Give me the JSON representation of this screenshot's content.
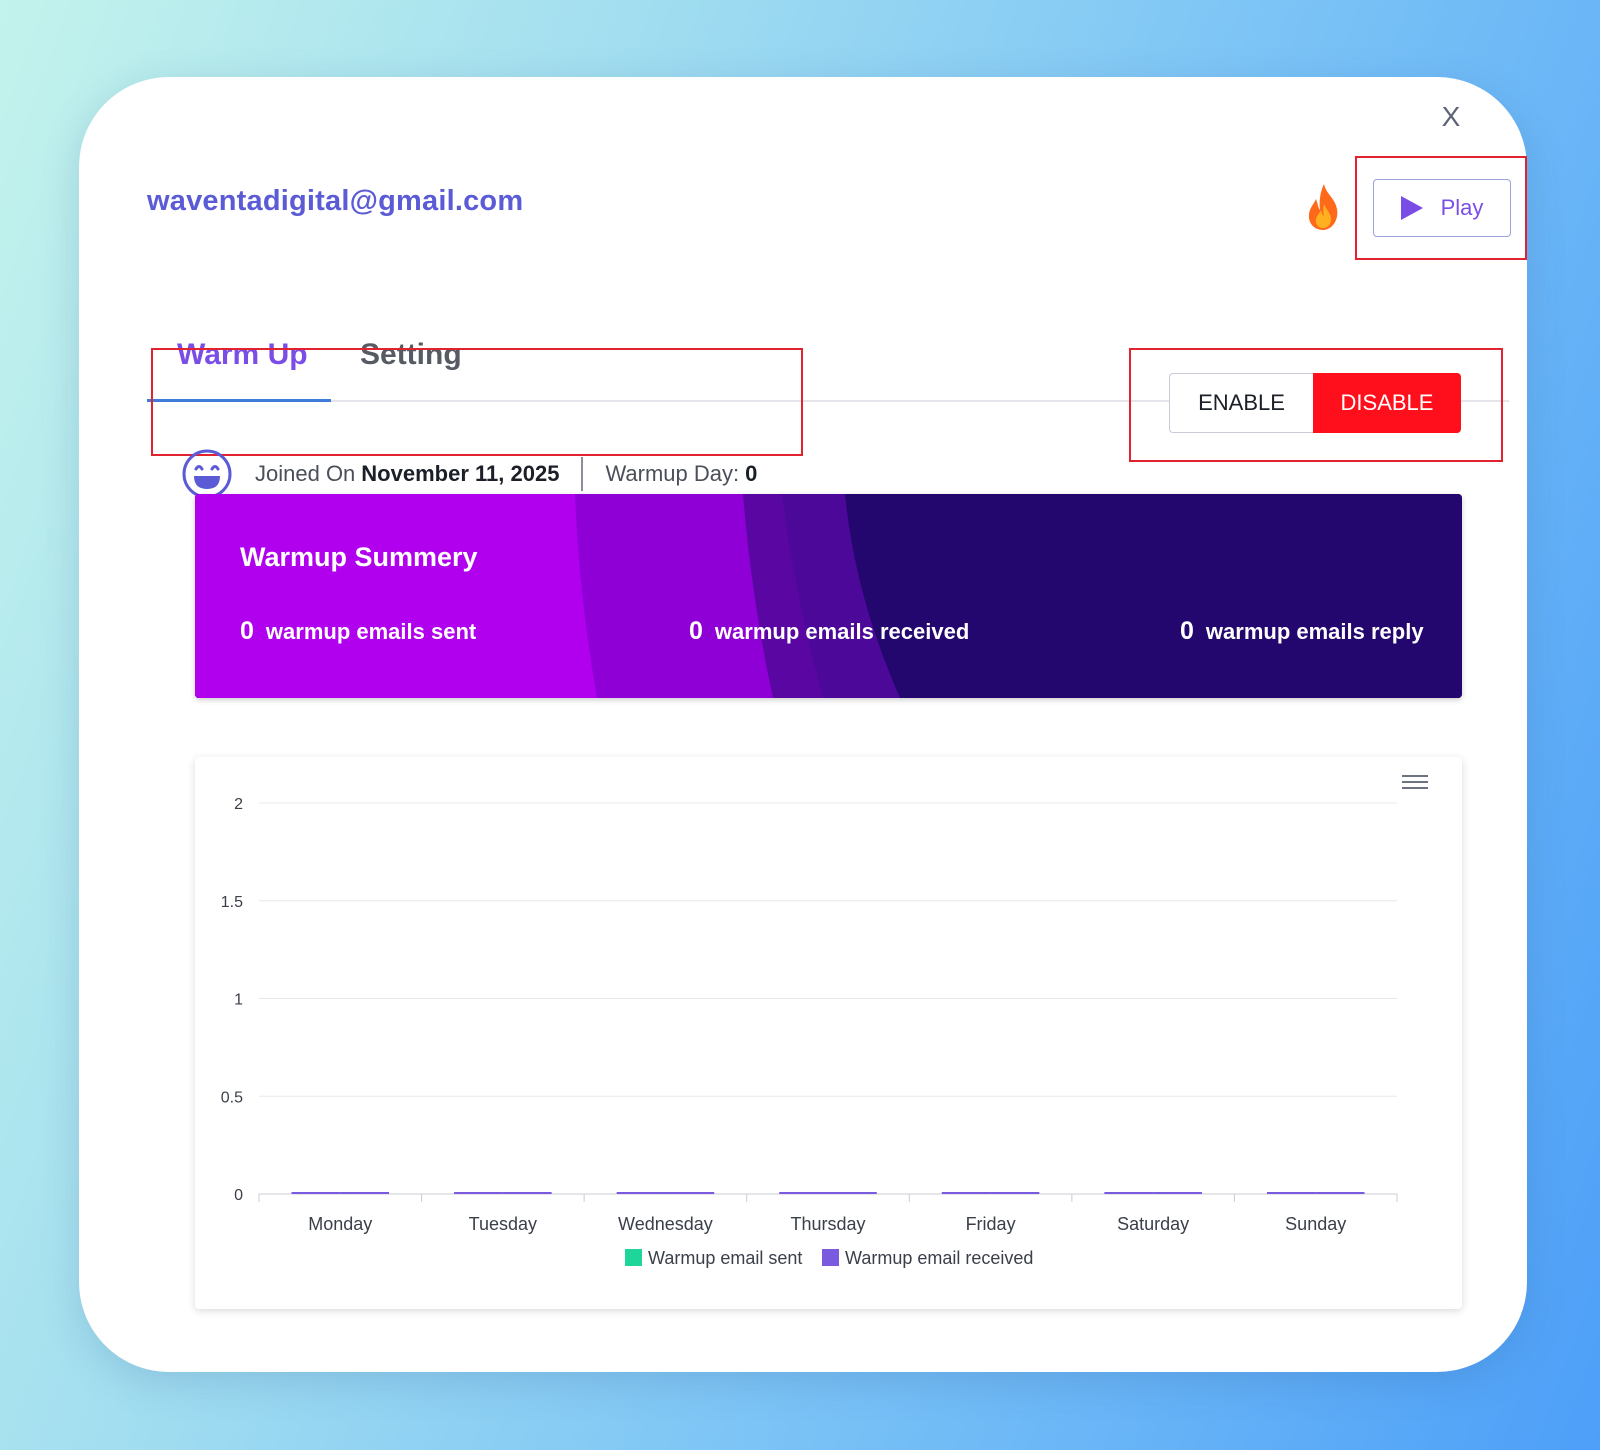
{
  "header": {
    "email": "waventadigital@gmail.com",
    "close_label": "X",
    "play_label": "Play"
  },
  "tabs": [
    {
      "label": "Warm Up",
      "active": true
    },
    {
      "label": "Setting",
      "active": false
    }
  ],
  "status": {
    "joined_label": "Joined On",
    "joined_date": "November 11, 2025",
    "warmup_day_label": "Warmup Day:",
    "warmup_day_value": "0"
  },
  "toggle": {
    "enable_label": "ENABLE",
    "disable_label": "DISABLE",
    "selected": "DISABLE"
  },
  "summary": {
    "title": "Warmup Summery",
    "stats": [
      {
        "value": "0",
        "label": "warmup emails sent"
      },
      {
        "value": "0",
        "label": "warmup emails received"
      },
      {
        "value": "0",
        "label": "warmup emails reply"
      }
    ]
  },
  "icons": {
    "close": "close-icon",
    "flame": "flame-icon",
    "play": "play-icon",
    "smiley": "smiley-icon",
    "menu": "menu-icon"
  },
  "colors": {
    "accent": "#7a4ee6",
    "email": "#5b5bd6",
    "disable": "#ff0f1b",
    "series_sent": "#1ed69a",
    "series_received": "#7a5be0"
  },
  "chart_data": {
    "type": "bar",
    "categories": [
      "Monday",
      "Tuesday",
      "Wednesday",
      "Thursday",
      "Friday",
      "Saturday",
      "Sunday"
    ],
    "series": [
      {
        "name": "Warmup email sent",
        "values": [
          0,
          0,
          0,
          0,
          0,
          0,
          0
        ]
      },
      {
        "name": "Warmup email received",
        "values": [
          0,
          0,
          0,
          0,
          0,
          0,
          0
        ]
      }
    ],
    "ylim": [
      0,
      2
    ],
    "yticks": [
      "0",
      "0.5",
      "1",
      "1.5",
      "2"
    ],
    "grid": true,
    "legend": "bottom"
  }
}
